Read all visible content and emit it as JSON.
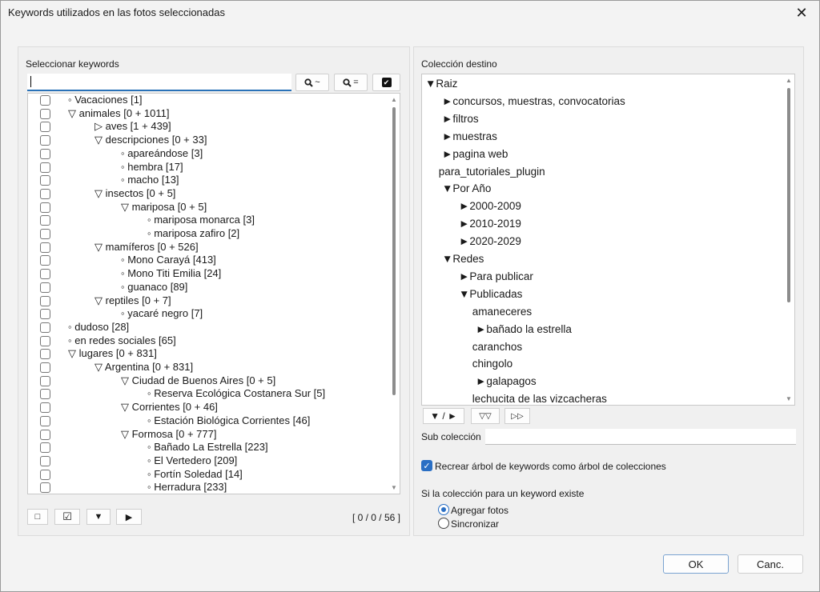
{
  "window": {
    "title": "Keywords utilizados en las fotos seleccionadas",
    "close_glyph": "✕"
  },
  "left_panel": {
    "label": "Seleccionar keywords",
    "search": {
      "value": "",
      "placeholder": ""
    },
    "toolbar": {
      "search_fuzzy": "~",
      "search_exact": "=",
      "check_all": "✔"
    },
    "tree": [
      {
        "label": "◦ Vacaciones [1]",
        "level": 0
      },
      {
        "label": "▽ animales [0 + 1011]",
        "level": 0
      },
      {
        "label": "▷ aves [1 + 439]",
        "level": 1
      },
      {
        "label": "▽ descripciones [0 + 33]",
        "level": 1
      },
      {
        "label": "◦ apareándose [3]",
        "level": 2
      },
      {
        "label": "◦ hembra [17]",
        "level": 2
      },
      {
        "label": "◦ macho [13]",
        "level": 2
      },
      {
        "label": "▽ insectos [0 + 5]",
        "level": 1
      },
      {
        "label": "▽ mariposa [0 + 5]",
        "level": 2
      },
      {
        "label": "◦ mariposa monarca [3]",
        "level": 3
      },
      {
        "label": "◦ mariposa zafiro [2]",
        "level": 3
      },
      {
        "label": "▽ mamíferos [0 + 526]",
        "level": 1
      },
      {
        "label": "◦ Mono Carayá [413]",
        "level": 2
      },
      {
        "label": "◦ Mono Titi Emilia [24]",
        "level": 2
      },
      {
        "label": "◦ guanaco [89]",
        "level": 2
      },
      {
        "label": "▽ reptiles [0 + 7]",
        "level": 1
      },
      {
        "label": "◦ yacaré negro [7]",
        "level": 2
      },
      {
        "label": "◦ dudoso [28]",
        "level": 0
      },
      {
        "label": "◦ en redes sociales [65]",
        "level": 0
      },
      {
        "label": "▽ lugares [0 + 831]",
        "level": 0
      },
      {
        "label": "▽ Argentina [0 + 831]",
        "level": 1
      },
      {
        "label": "▽ Ciudad de Buenos Aires [0 + 5]",
        "level": 2
      },
      {
        "label": "◦ Reserva Ecológica Costanera Sur [5]",
        "level": 3
      },
      {
        "label": "▽ Corrientes [0 + 46]",
        "level": 2
      },
      {
        "label": "◦ Estación Biológica Corrientes [46]",
        "level": 3
      },
      {
        "label": "▽ Formosa [0 + 777]",
        "level": 2
      },
      {
        "label": "◦ Bañado La Estrella [223]",
        "level": 3
      },
      {
        "label": "◦ El Vertedero [209]",
        "level": 3
      },
      {
        "label": "◦ Fortín Soledad [14]",
        "level": 3
      },
      {
        "label": "◦ Herradura [233]",
        "level": 3
      }
    ],
    "bottom_buttons": {
      "uncheck_all": "□",
      "check_all": "☑",
      "expand": "▼",
      "collapse": "▶"
    },
    "counter": "[ 0 / 0 / 56 ]"
  },
  "right_panel": {
    "label": "Colección destino",
    "tree": [
      {
        "label": "▼Raiz",
        "level": 0
      },
      {
        "label": "►concursos, muestras, convocatorias",
        "level": 1
      },
      {
        "label": "►filtros",
        "level": 1
      },
      {
        "label": "►muestras",
        "level": 1
      },
      {
        "label": "►pagina web",
        "level": 1
      },
      {
        "label": "para_tutoriales_plugin",
        "level": 0.8
      },
      {
        "label": "▼Por Año",
        "level": 1
      },
      {
        "label": "►2000-2009",
        "level": 2
      },
      {
        "label": "►2010-2019",
        "level": 2
      },
      {
        "label": "►2020-2029",
        "level": 2
      },
      {
        "label": "▼Redes",
        "level": 1
      },
      {
        "label": "►Para publicar",
        "level": 2
      },
      {
        "label": "▼Publicadas",
        "level": 2
      },
      {
        "label": "amaneceres",
        "level": 2.8
      },
      {
        "label": "►bañado la estrella",
        "level": 3
      },
      {
        "label": "caranchos",
        "level": 2.8
      },
      {
        "label": "chingolo",
        "level": 2.8
      },
      {
        "label": "►galapagos",
        "level": 3
      },
      {
        "label": "lechucita de las vizcacheras",
        "level": 2.8
      }
    ],
    "buttons": {
      "toggle": "▼ / ►",
      "expand_all": "▽▽",
      "forward": "▷▷"
    },
    "subcoleccion_label": "Sub colección",
    "subcoleccion_value": "",
    "recrear_label": "Recrear árbol de keywords como árbol de colecciones",
    "exists_label": "Si la colección para un keyword existe",
    "radio_agregar": "Agregar fotos",
    "radio_sincronizar": "Sincronizar"
  },
  "footer": {
    "ok": "OK",
    "cancel": "Canc."
  },
  "colors": {
    "accent": "#2a6fc4"
  }
}
